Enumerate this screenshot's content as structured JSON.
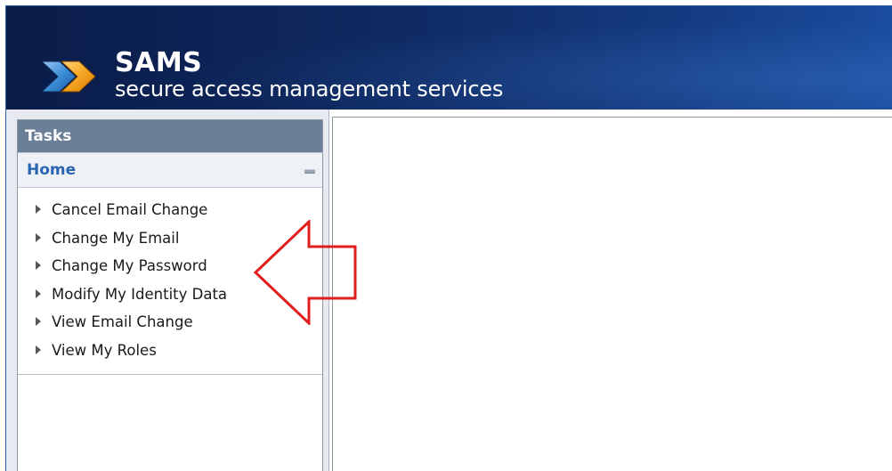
{
  "header": {
    "brand_name": "SAMS",
    "brand_tagline": "secure access management services",
    "logo_icon": "double-chevron-arrow-icon",
    "colors": {
      "gradient_start": "#0a1c48",
      "gradient_end": "#1a4c9e",
      "arrow_orange": "#f5a623",
      "arrow_blue": "#3c8fd8"
    }
  },
  "sidebar": {
    "panel_title": "Tasks",
    "section": {
      "title": "Home",
      "collapse_icon": "minus-icon",
      "items": [
        {
          "label": "Cancel Email Change"
        },
        {
          "label": "Change My Email"
        },
        {
          "label": "Change My Password"
        },
        {
          "label": "Modify My Identity Data"
        },
        {
          "label": "View Email Change"
        },
        {
          "label": "View My Roles"
        }
      ]
    }
  },
  "annotation": {
    "icon": "red-outline-arrow-icon",
    "color": "#e01e1e"
  }
}
